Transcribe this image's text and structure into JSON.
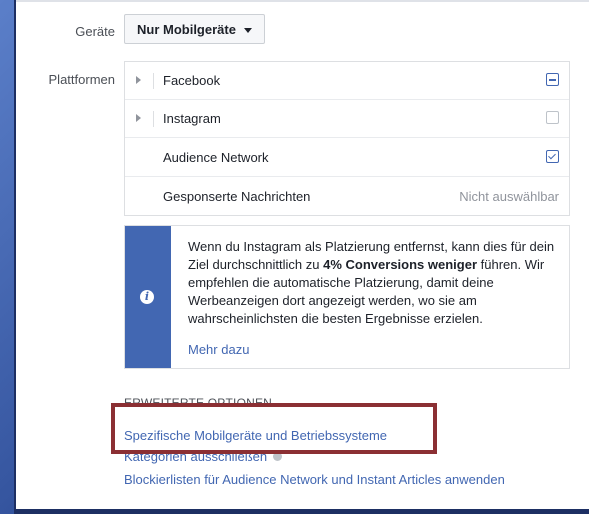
{
  "devices": {
    "label": "Geräte",
    "dropdown_value": "Nur Mobilgeräte"
  },
  "platforms": {
    "label": "Plattformen",
    "items": [
      {
        "name": "Facebook",
        "state": "indeterminate",
        "expandable": true
      },
      {
        "name": "Instagram",
        "state": "unchecked",
        "expandable": true
      },
      {
        "name": "Audience Network",
        "state": "checked",
        "expandable": false
      },
      {
        "name": "Gesponserte Nachrichten",
        "state": "unavailable",
        "expandable": false,
        "status_text": "Nicht auswählbar"
      }
    ]
  },
  "info": {
    "icon": "info-icon",
    "text_before": "Wenn du Instagram als Platzierung entfernst, kann dies für dein Ziel durchschnittlich zu ",
    "text_bold": "4% Conversions weniger",
    "text_after": " führen. Wir empfehlen die automatische Platzierung, damit deine Werbeanzeigen dort angezeigt werden, wo sie am wahrscheinlichsten die besten Ergebnisse erzielen.",
    "link": "Mehr dazu"
  },
  "advanced": {
    "title": "ERWEITERTE OPTIONEN",
    "links": [
      "Spezifische Mobilgeräte und Betriebssysteme",
      "Kategorien ausschließen",
      "Blockierlisten für Audience Network und Instant Articles anwenden"
    ]
  },
  "colors": {
    "accent": "#4267b2",
    "highlight": "#8b2f33",
    "background": "#2e4d97"
  }
}
